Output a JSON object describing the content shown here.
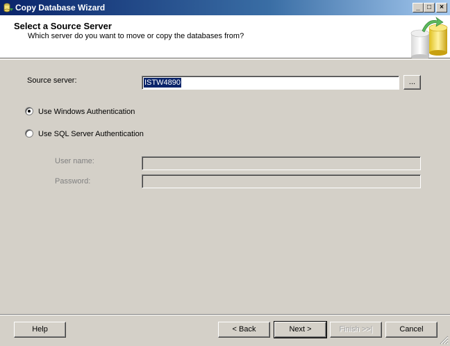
{
  "window": {
    "title": "Copy Database Wizard",
    "controls": {
      "minimize": "_",
      "maximize": "□",
      "close": "×"
    }
  },
  "header": {
    "title": "Select a Source Server",
    "subtitle": "Which server do you want to move or copy the databases from?"
  },
  "form": {
    "source_server_label": "Source server:",
    "source_server_value": "ISTW4890",
    "browse_label": "...",
    "auth_windows_label": "Use Windows Authentication",
    "auth_windows_selected": true,
    "auth_sql_label": "Use SQL Server Authentication",
    "auth_sql_selected": false,
    "user_name_label": "User name:",
    "user_name_value": "",
    "password_label": "Password:",
    "password_value": ""
  },
  "footer": {
    "help": "Help",
    "back": "< Back",
    "next": "Next >",
    "finish": "Finish >>|",
    "cancel": "Cancel"
  },
  "colors": {
    "titlebar_start": "#0a246a",
    "titlebar_end": "#a6caf0",
    "face": "#d4d0c8",
    "selection": "#0a246a"
  }
}
